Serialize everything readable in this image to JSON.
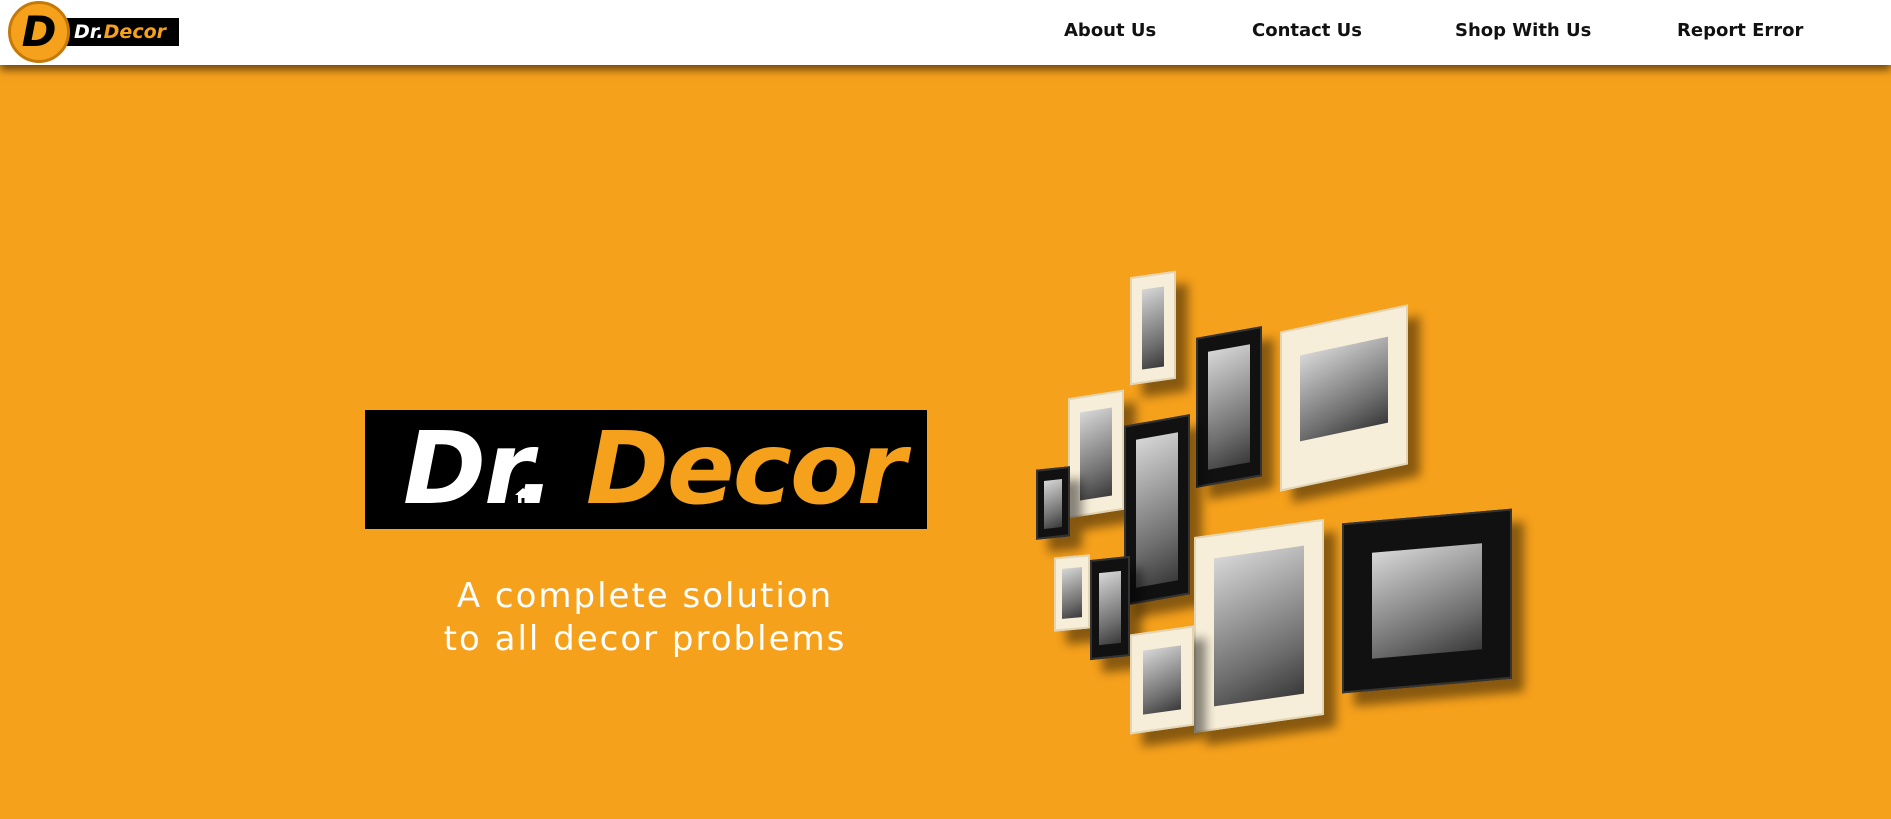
{
  "brand": {
    "logo_letter": "D",
    "name_part1": "Dr.",
    "name_part2": "Decor",
    "colors": {
      "accent": "#f6a11c",
      "dark": "#000000",
      "light": "#ffffff"
    }
  },
  "nav": {
    "items": [
      {
        "label": "About Us"
      },
      {
        "label": "Contact Us"
      },
      {
        "label": "Shop With Us"
      },
      {
        "label": "Report Error"
      }
    ]
  },
  "hero": {
    "logo_part1": "Dr.",
    "logo_part2": "Decor",
    "logo_icon": "home-icon",
    "tagline_line1": "A complete solution",
    "tagline_line2": "to all decor problems",
    "image_subject": "picture-frame-collage"
  }
}
